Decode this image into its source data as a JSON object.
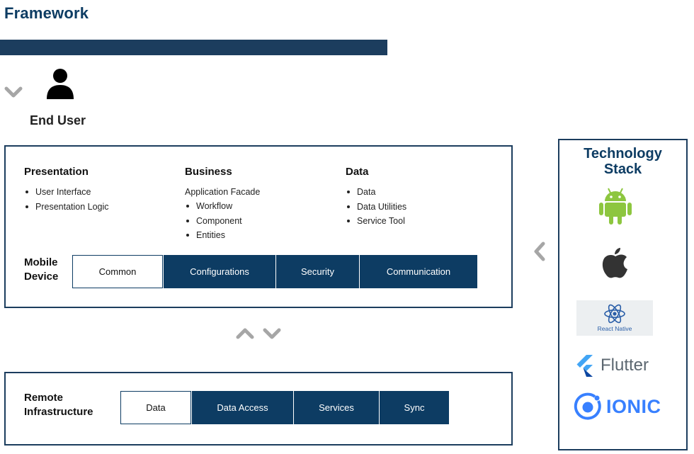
{
  "header": {
    "title": "Framework"
  },
  "end_user": {
    "label": "End User"
  },
  "mobile": {
    "presentation": {
      "title": "Presentation",
      "items": [
        "User Interface",
        "Presentation Logic"
      ]
    },
    "business": {
      "title": "Business",
      "intro": "Application Facade",
      "items": [
        "Workflow",
        "Component",
        "Entities"
      ]
    },
    "data": {
      "title": "Data",
      "items": [
        "Data",
        "Data Utilities",
        "Service Tool"
      ]
    },
    "device_label_line1": "Mobile",
    "device_label_line2": "Device",
    "layers": [
      "Common",
      "Configurations",
      "Security",
      "Communication"
    ]
  },
  "remote": {
    "label_line1": "Remote",
    "label_line2": "Infrastructure",
    "layers": [
      "Data",
      "Data Access",
      "Services",
      "Sync"
    ]
  },
  "tech_stack": {
    "title_line1": "Technology",
    "title_line2": "Stack",
    "react_label": "React Native",
    "flutter_label": "Flutter",
    "ionic_label": "IONIC"
  },
  "colors": {
    "primary": "#0d3c63",
    "android": "#8dc63f",
    "react": "#2a5ea8",
    "ionic": "#3880ff",
    "chevron": "#a6a6a6"
  }
}
